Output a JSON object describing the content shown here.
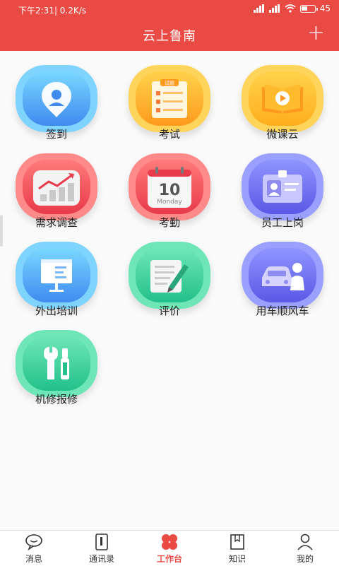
{
  "status": {
    "time_speed": "下午2:31| 0.2K/s",
    "battery": "45",
    "battery_level": 0.45
  },
  "header": {
    "title": "云上鲁南",
    "add_label": "+"
  },
  "tiles": [
    {
      "label": "签到"
    },
    {
      "label": "考试",
      "paper_text": "试题"
    },
    {
      "label": "微课云"
    },
    {
      "label": "需求调查"
    },
    {
      "label": "考勤",
      "cal_day": "10",
      "cal_weekday": "Monday"
    },
    {
      "label": "员工上岗"
    },
    {
      "label": "外出培训"
    },
    {
      "label": "评价"
    },
    {
      "label": "用车顺风车"
    },
    {
      "label": "机修报修"
    }
  ],
  "tabs": [
    {
      "label": "消息"
    },
    {
      "label": "通讯录"
    },
    {
      "label": "工作台"
    },
    {
      "label": "知识"
    },
    {
      "label": "我的"
    }
  ],
  "colors": {
    "header": "#e94a44",
    "active_tab": "#e94a44"
  }
}
